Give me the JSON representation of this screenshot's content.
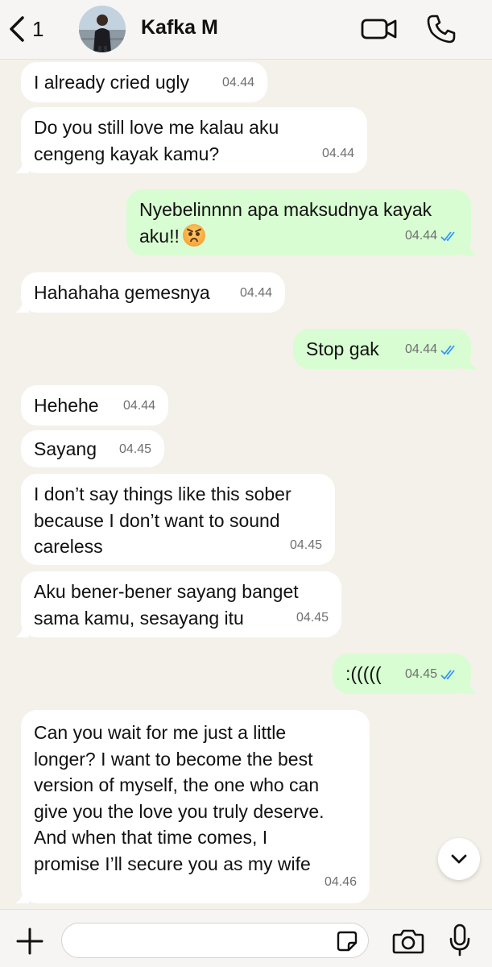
{
  "header": {
    "back_count": "1",
    "contact_name": "Kafka M"
  },
  "messages": [
    {
      "dir": "in",
      "text": "I already cried ugly",
      "time": "04.44"
    },
    {
      "dir": "in",
      "text": "Do you still love me kalau aku\ncengeng kayak kamu?",
      "time": "04.44"
    },
    {
      "dir": "out",
      "text": "Nyebelinnnn apa maksudnya kayak\naku!!",
      "emoji": "angry-face-emoji",
      "time": "04.44",
      "status": "read"
    },
    {
      "dir": "in",
      "text": "Hahahaha gemesnya",
      "time": "04.44"
    },
    {
      "dir": "out",
      "text": "Stop gak",
      "time": "04.44",
      "status": "read"
    },
    {
      "dir": "in",
      "text": "Hehehe",
      "time": "04.44"
    },
    {
      "dir": "in",
      "text": "Sayang",
      "time": "04.45"
    },
    {
      "dir": "in",
      "text": "I don’t say things like this sober\nbecause I don’t want to sound\ncareless",
      "time": "04.45"
    },
    {
      "dir": "in",
      "text": "Aku bener-bener sayang banget\nsama kamu, sesayang itu",
      "time": "04.45"
    },
    {
      "dir": "out",
      "text": ":(((((",
      "time": "04.45",
      "status": "read"
    },
    {
      "dir": "in",
      "text": "Can you wait for me just a little\nlonger? I want to become the best\nversion of myself, the one who can\ngive you the love you truly deserve.\nAnd when that time comes, I\npromise I’ll secure you as my wife",
      "time": "04.46"
    }
  ],
  "composer": {
    "placeholder": ""
  },
  "icons": {
    "back": "chevron-left-icon",
    "video": "video-camera-icon",
    "call": "phone-icon",
    "scroll": "chevron-down-icon",
    "plus": "plus-icon",
    "sticker": "sticker-icon",
    "camera": "camera-icon",
    "mic": "microphone-icon"
  },
  "colors": {
    "background": "#f4f1ea",
    "incoming_bubble": "#ffffff",
    "outgoing_bubble": "#d8fdd2",
    "read_ticks": "#3497f9"
  }
}
